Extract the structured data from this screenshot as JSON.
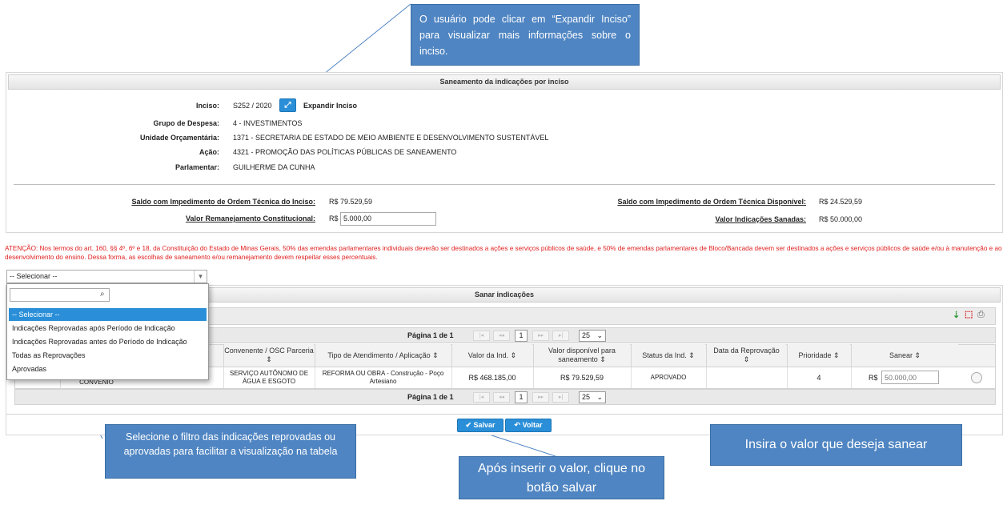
{
  "callouts": {
    "top": "O usuário pode clicar em “Expandir Inciso” para visualizar mais informações sobre o inciso.",
    "filter": "Selecione o filtro das indicações reprovadas ou aprovadas para facilitar a visualização na tabela",
    "save": "Após inserir o valor, clique no botão salvar",
    "sanear": "Insira o valor que deseja sanear"
  },
  "panel": {
    "title": "Saneamento da indicações por inciso",
    "inciso_label": "Inciso:",
    "inciso_value": "S252 / 2020",
    "expand_label": "Expandir Inciso",
    "grupo_label": "Grupo de Despesa:",
    "grupo_value": "4 - INVESTIMENTOS",
    "unidade_label": "Unidade Orçamentária:",
    "unidade_value": "1371 - SECRETARIA DE ESTADO DE MEIO AMBIENTE E DESENVOLVIMENTO SUSTENTÁVEL",
    "acao_label": "Ação:",
    "acao_value": "4321 - PROMOÇÃO DAS POLÍTICAS PÚBLICAS DE SANEAMENTO",
    "parlamentar_label": "Parlamentar:",
    "parlamentar_value": "GUILHERME DA CUNHA",
    "saldo_inciso_label": "Saldo com Impedimento de Ordem Técnica do Inciso:",
    "saldo_inciso_value": "R$ 79.529,59",
    "remanejamento_label": "Valor Remanejamento Constitucional:",
    "currency": "R$",
    "remanejamento_value": "5.000,00",
    "saldo_disp_label": "Saldo com Impedimento de Ordem Técnica Disponível:",
    "saldo_disp_value": "R$ 24.529,59",
    "sanadas_label": "Valor Indicações Sanadas:",
    "sanadas_value": "R$ 50.000,00"
  },
  "warning": "ATENÇÃO: Nos termos do art. 160, §§ 4º, 6º e 18, da Constituição do Estado de Minas Gerais, 50% das emendas parlamentares individuais deverão ser destinados a ações e serviços públicos de saúde, e 50% de emendas parlamentares de Bloco/Bancada devem ser destinados a ações e serviços públicos de saúde e/ou à manutenção e ao desenvolvimento do ensino. Dessa forma, as escolhas de saneamento e/ou remanejamento devem respeitar esses percentuais.",
  "filter": {
    "selected": "-- Selecionar --",
    "search_value": "",
    "options": [
      "-- Selecionar --",
      "Indicações Reprovadas após Período de Indicação",
      "Indicações Reprovadas antes do Período de Indicação",
      "Todas as Reprovações",
      "Aprovadas"
    ]
  },
  "sanar": {
    "title": "Sanar indicações",
    "page_label": "Página 1 de 1",
    "page_num": "1",
    "page_size": "25",
    "columns": [
      "Convenente / OSC Parceria",
      "Tipo de Atendimento / Aplicação",
      "Valor da Ind.",
      "Valor disponível para saneamento",
      "Status da Ind.",
      "Data da Reprovação",
      "Prioridade",
      "Sanear"
    ],
    "row": {
      "col_hidden_fragment": "CONVENIO",
      "convenente": "SERVIÇO AUTÔNOMO DE ÁGUA E ESGOTO",
      "tipo": "REFORMA OU OBRA - Construção - Poço Artesiano",
      "valor_ind": "R$ 468.185,00",
      "valor_disp": "R$ 79.529,59",
      "status": "APROVADO",
      "data_reprov": "",
      "prioridade": "4",
      "sanear_currency": "R$",
      "sanear_placeholder": "50.000,00"
    },
    "save_label": "Salvar",
    "back_label": "Voltar"
  },
  "colors": {
    "accent": "#2a8fd8",
    "callout": "#4f85c2",
    "warning": "#e02020"
  }
}
